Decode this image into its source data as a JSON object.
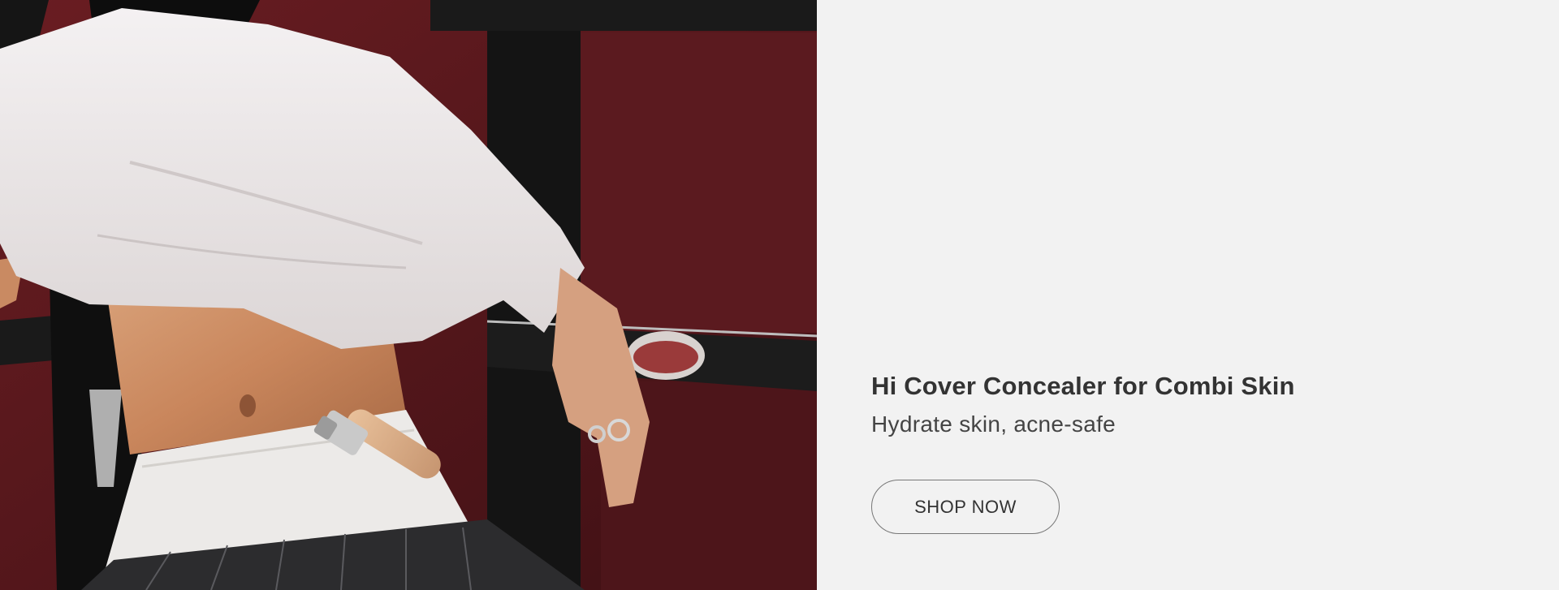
{
  "hero": {
    "image_alt": "Model in white oversized tee with concealer tube tucked into waistband",
    "title": "Hi Cover Concealer for Combi Skin",
    "subtitle": "Hydrate skin, acne-safe",
    "cta_label": "SHOP NOW"
  },
  "colors": {
    "panel_background": "#f2f2f2",
    "title_text": "#333333",
    "button_border": "#777777",
    "photo_wall": "#5a1a1e"
  }
}
